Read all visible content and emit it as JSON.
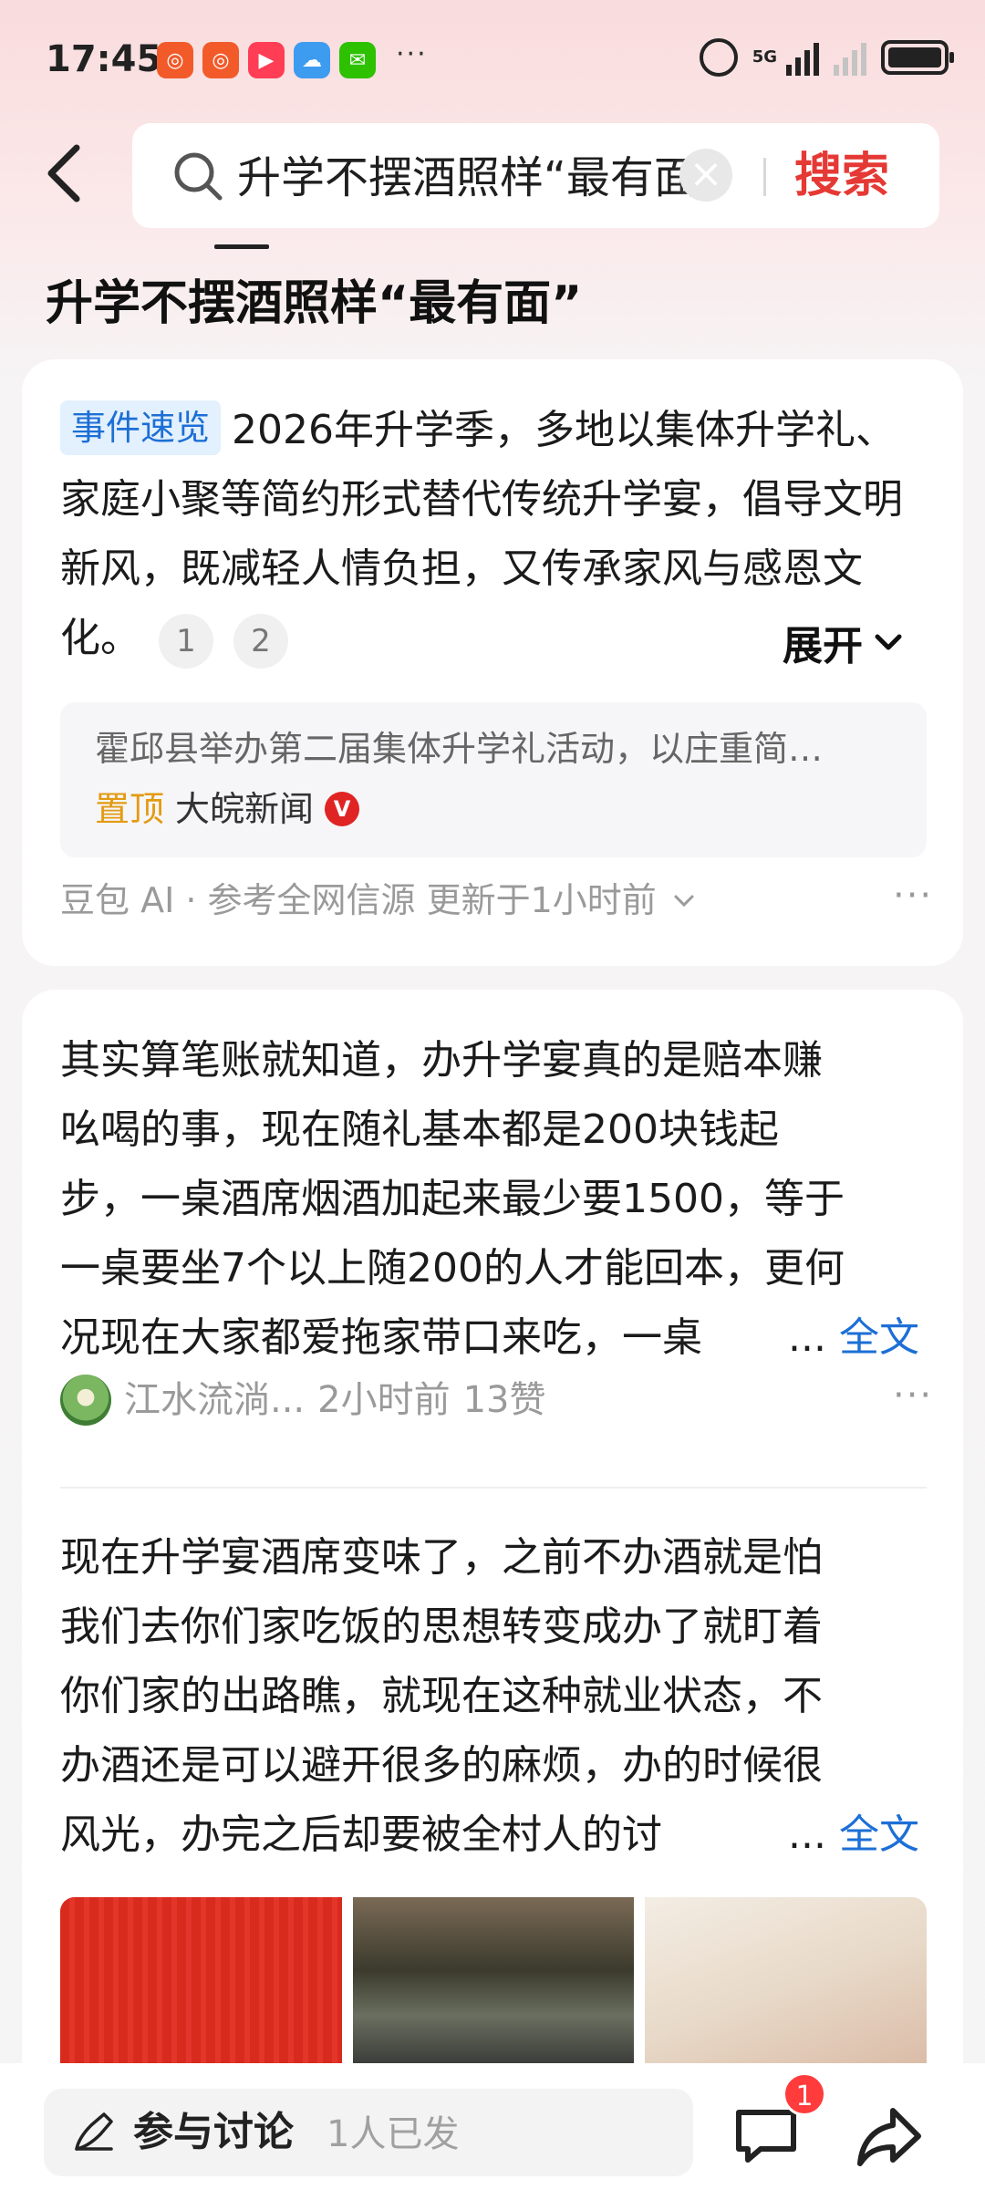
{
  "status_bar": {
    "time": "17:45",
    "network": "5G",
    "dots": "···"
  },
  "search": {
    "query": "升学不摆酒照样“最有面”",
    "button": "搜索"
  },
  "page_title": "升学不摆酒照样“最有面”",
  "summary_card": {
    "tag": "事件速览",
    "text": "2026年升学季，多地以集体升学礼、家庭小聚等简约形式替代传统升学宴，倡导文明新风，既减轻人情负担，又传承家风与感恩文化。",
    "citations": [
      "1",
      "2"
    ],
    "expand_label": "展开",
    "source_title": "霍邱县举办第二届集体升学礼活动，以庄重简…",
    "source_pinned": "置顶",
    "source_media": "大皖新闻",
    "verified": "V",
    "ai_footer": "豆包 AI · 参考全网信源 更新于1小时前"
  },
  "posts": [
    {
      "lines": [
        "其实算笔账就知道，办升学宴真的是赔本赚",
        "吆喝的事，现在随礼基本都是200块钱起",
        "步，一桌酒席烟酒加起来最少要1500，等于",
        "一桌要坐7个以上随200的人才能回本，更何",
        "况现在大家都爱拖家带口来吃，一桌"
      ],
      "ellipsis": "...",
      "fulltext": "全文",
      "author": "江水流淌...",
      "time": "2小时前",
      "likes": "13赞"
    },
    {
      "lines": [
        "现在升学宴酒席变味了，之前不办酒就是怕",
        "我们去你们家吃饭的思想转变成办了就盯着",
        "你们家的出路瞧，就现在这种就业状态，不",
        "办酒还是可以避开很多的麻烦，办的时候很",
        "风光，办完之后却要被全村人的讨"
      ],
      "ellipsis": "...",
      "fulltext": "全文"
    }
  ],
  "bottom_bar": {
    "discuss_label": "参与讨论",
    "discuss_count": "1人已发",
    "comment_badge": "1"
  },
  "colors": {
    "accent_red": "#e53935",
    "link_blue": "#1c6fd6",
    "pinned_orange": "#e39a12"
  }
}
